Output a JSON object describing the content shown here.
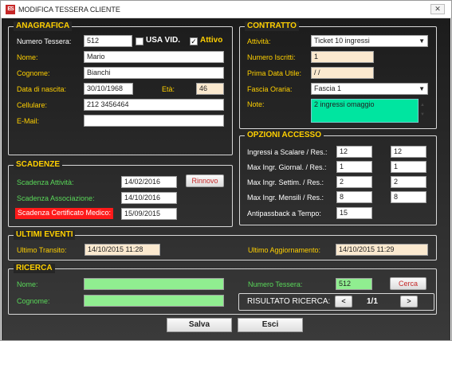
{
  "window": {
    "icon_text": "ES",
    "title": "MODIFICA TESSERA CLIENTE",
    "close_label": "✕"
  },
  "anagrafica": {
    "title": "ANAGRAFICA",
    "numero_tessera_label": "Numero Tessera:",
    "numero_tessera_value": "512",
    "usa_vid_label": "USA VID.",
    "attivo_label": "Attivo",
    "attivo_check": "✓",
    "nome_label": "Nome:",
    "nome_value": "Mario",
    "cognome_label": "Cognome:",
    "cognome_value": "Bianchi",
    "data_nascita_label": "Data di nascita:",
    "data_nascita_value": "30/10/1968",
    "eta_label": "Età:",
    "eta_value": "46",
    "cellulare_label": "Cellulare:",
    "cellulare_value": "212 3456464",
    "email_label": "E-Mail:",
    "email_value": ""
  },
  "contratto": {
    "title": "CONTRATTO",
    "attivita_label": "Attività:",
    "attivita_value": "Ticket 10 ingressi",
    "numero_iscritti_label": "Numero Iscritti:",
    "numero_iscritti_value": "1",
    "prima_data_label": "Prima Data Utile:",
    "prima_data_value": " / /",
    "fascia_label": "Fascia Oraria:",
    "fascia_value": "Fascia 1",
    "note_label": "Note:",
    "note_value": "2 ingressi omaggio"
  },
  "scadenze": {
    "title": "SCADENZE",
    "attivita_label": "Scadenza Attività:",
    "attivita_value": "14/02/2016",
    "rinnovo_label": "Rinnovo",
    "associazione_label": "Scadenza Associazione:",
    "associazione_value": "14/10/2016",
    "certificato_label": "Scadenza Certificato Medico:",
    "certificato_value": "15/09/2015"
  },
  "opzioni": {
    "title": "OPZIONI ACCESSO",
    "rows": [
      {
        "label": "Ingressi a Scalare / Res.:",
        "v1": "12",
        "v2": "12"
      },
      {
        "label": "Max Ingr. Giornal. / Res.:",
        "v1": "1",
        "v2": "1"
      },
      {
        "label": "Max Ingr. Settim. / Res.:",
        "v1": "2",
        "v2": "2"
      },
      {
        "label": "Max Ingr. Mensili / Res.:",
        "v1": "8",
        "v2": "8"
      }
    ],
    "antipassback_label": "Antipassback a Tempo:",
    "antipassback_value": "15"
  },
  "ultimi_eventi": {
    "title": "ULTIMI EVENTI",
    "transito_label": "Ultimo Transito:",
    "transito_value": "14/10/2015 11:28",
    "aggiornamento_label": "Ultimo Aggiornamento:",
    "aggiornamento_value": "14/10/2015 11:29"
  },
  "ricerca": {
    "title": "RICERCA",
    "nome_label": "Nome:",
    "nome_value": "",
    "cognome_label": "Cognome:",
    "cognome_value": "",
    "numero_tessera_label": "Numero Tessera:",
    "numero_tessera_value": "512",
    "cerca_label": "Cerca",
    "risultato_label": "RISULTATO RICERCA:",
    "prev_label": "<",
    "next_label": ">",
    "pagination": "1/1"
  },
  "footer": {
    "salva_label": "Salva",
    "esci_label": "Esci"
  },
  "colors": {
    "background": "#2b2b2b",
    "section_title": "#ffd000",
    "label_green": "#59d859",
    "alert_red": "#ff1a1a",
    "field_peach": "#fbe9cf",
    "field_green": "#90ee90",
    "note_mint": "#00e5a0"
  }
}
